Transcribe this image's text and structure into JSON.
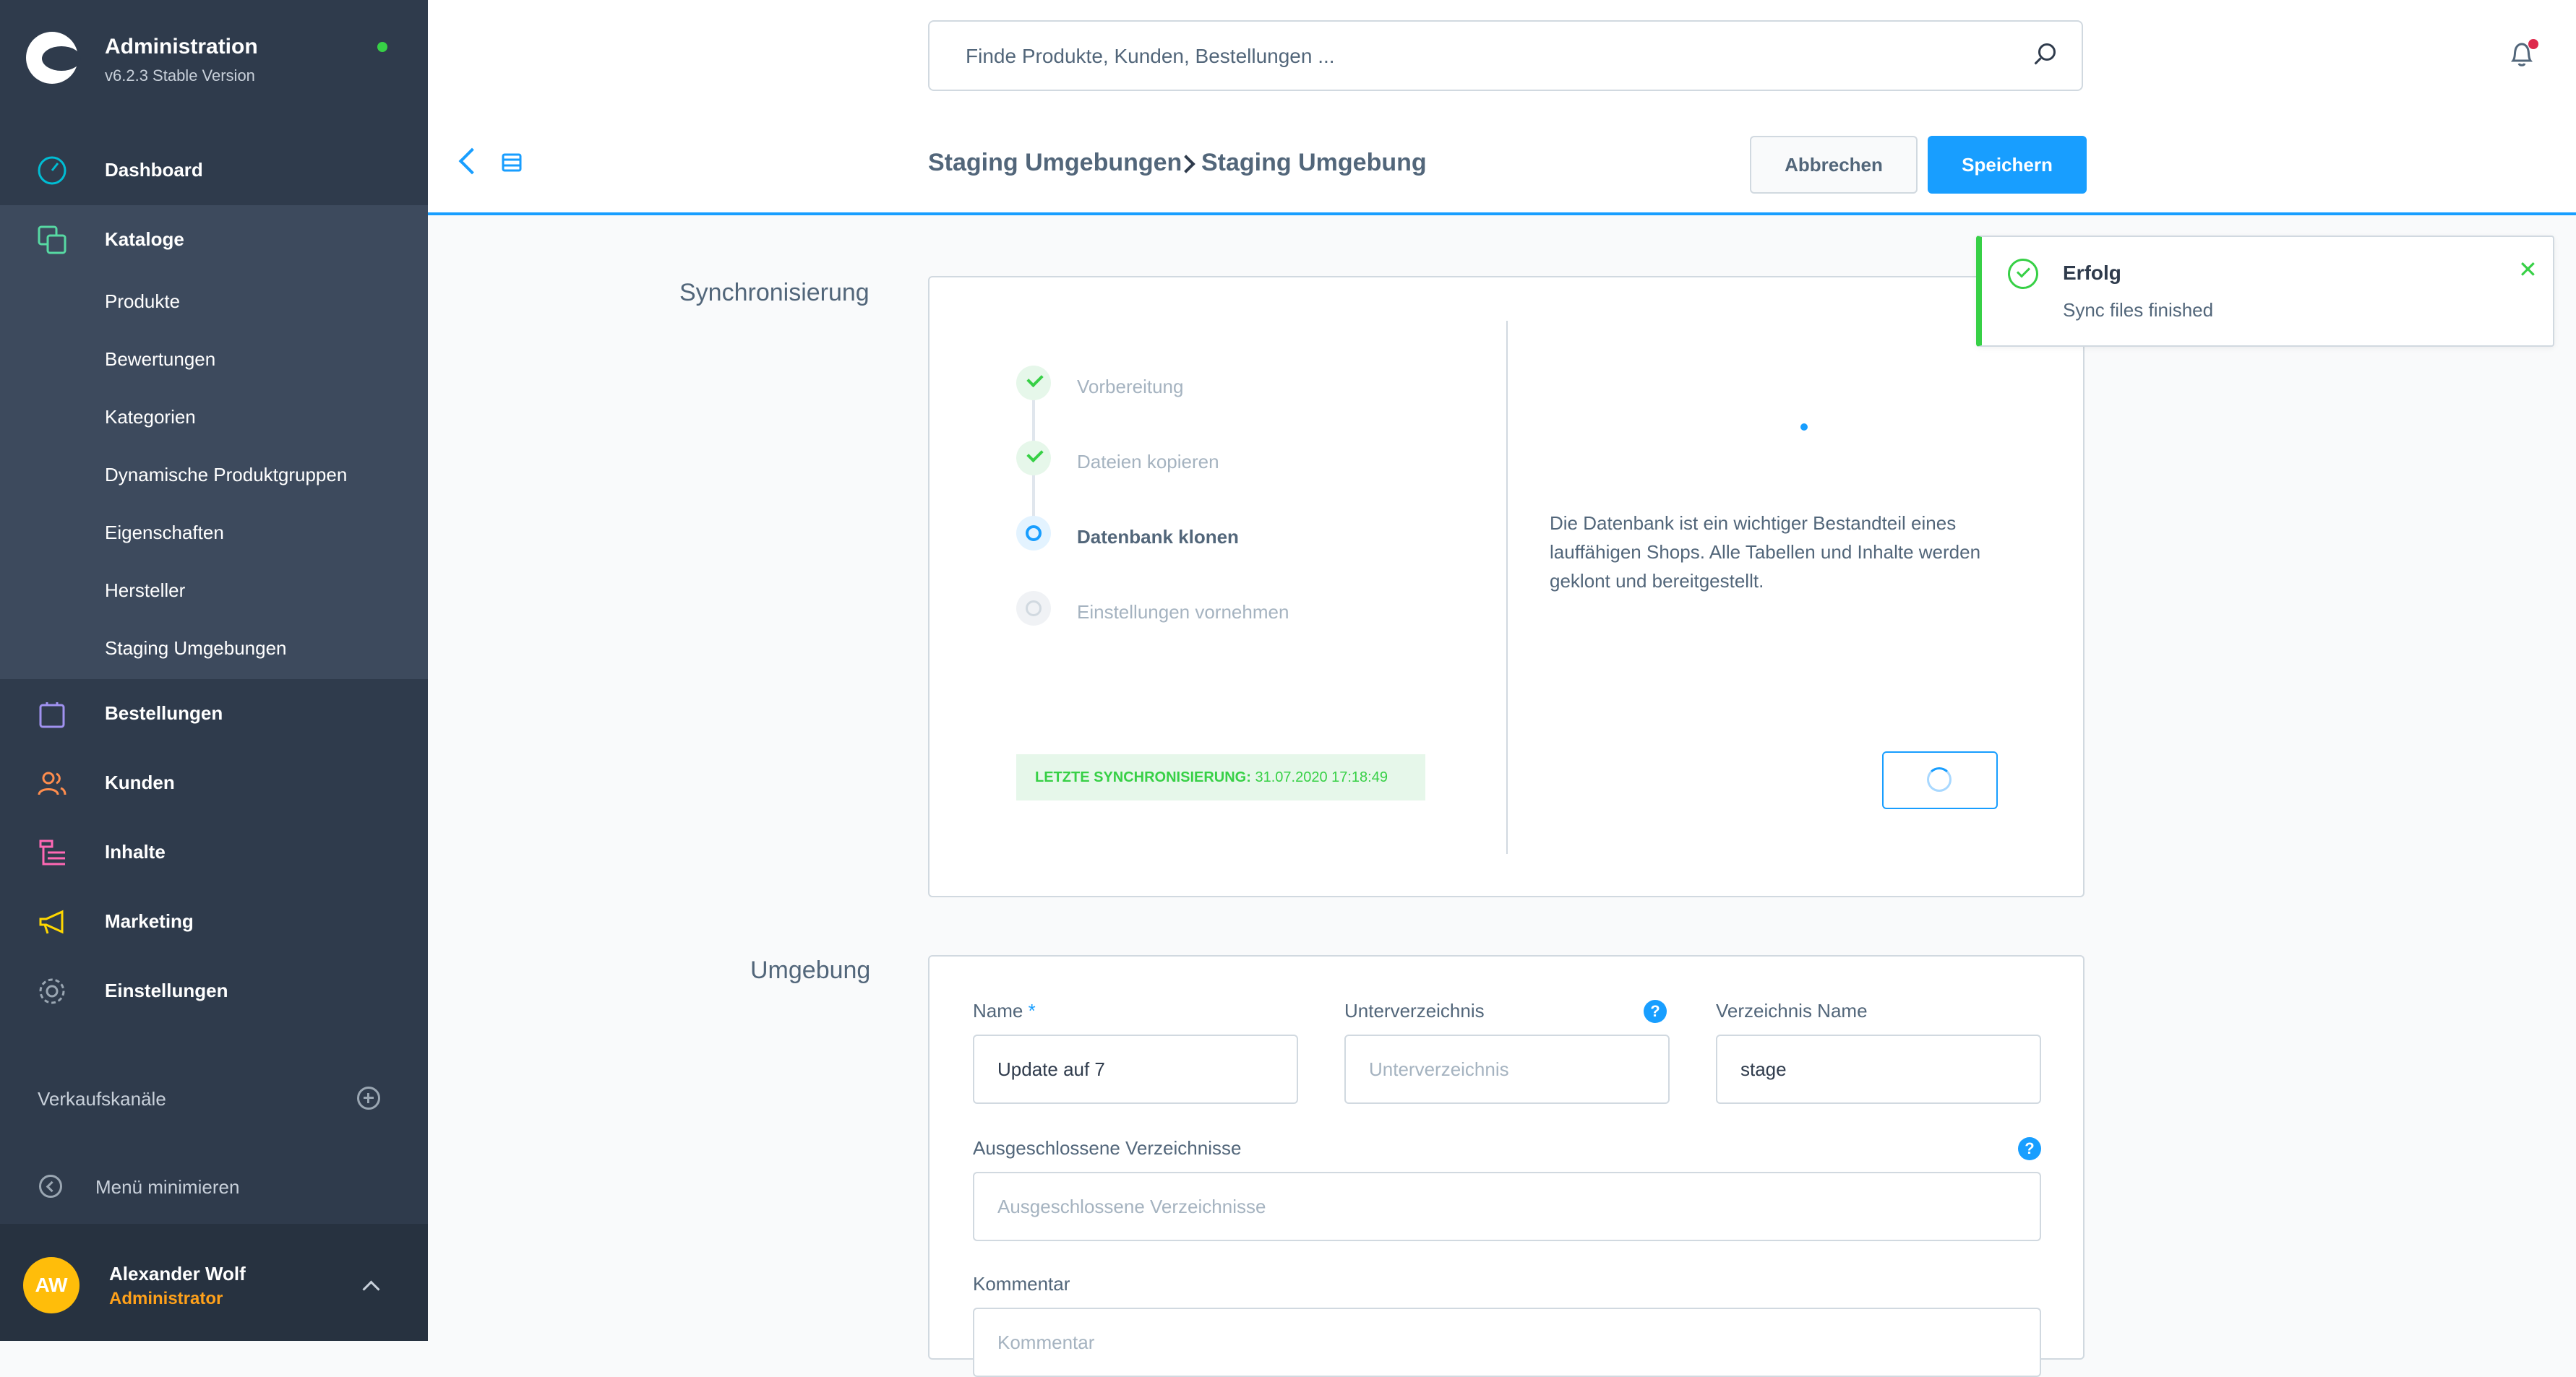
{
  "brand": {
    "title": "Administration",
    "version": "v6.2.3 Stable Version"
  },
  "sidebar": {
    "main": [
      {
        "label": "Dashboard",
        "icon": "dashboard-icon"
      },
      {
        "label": "Kataloge",
        "icon": "catalog-icon"
      },
      {
        "label": "Bestellungen",
        "icon": "orders-icon"
      },
      {
        "label": "Kunden",
        "icon": "customers-icon"
      },
      {
        "label": "Inhalte",
        "icon": "content-icon"
      },
      {
        "label": "Marketing",
        "icon": "marketing-icon"
      },
      {
        "label": "Einstellungen",
        "icon": "settings-icon"
      }
    ],
    "catalog_sub": [
      "Produkte",
      "Bewertungen",
      "Kategorien",
      "Dynamische Produktgruppen",
      "Eigenschaften",
      "Hersteller",
      "Staging Umgebungen"
    ],
    "sales_channels": "Verkaufskanäle",
    "minimize": "Menü minimieren"
  },
  "user": {
    "initials": "AW",
    "name": "Alexander Wolf",
    "role": "Administrator"
  },
  "search": {
    "placeholder": "Finde Produkte, Kunden, Bestellungen ..."
  },
  "breadcrumb": {
    "parent": "Staging Umgebungen",
    "current": "Staging Umgebung"
  },
  "actions": {
    "cancel": "Abbrechen",
    "save": "Speichern"
  },
  "sync": {
    "section_label": "Synchronisierung",
    "steps": [
      {
        "label": "Vorbereitung",
        "state": "done"
      },
      {
        "label": "Dateien kopieren",
        "state": "done"
      },
      {
        "label": "Datenbank klonen",
        "state": "active"
      },
      {
        "label": "Einstellungen vornehmen",
        "state": "todo"
      }
    ],
    "last_sync_label": "LETZTE SYNCHRONISIERUNG:",
    "last_sync_value": "31.07.2020 17:18:49",
    "description": "Die Datenbank ist ein wichtiger Bestandteil eines lauffähigen Shops. Alle Tabellen und Inhalte werden geklont und bereitgestellt."
  },
  "environment": {
    "section_label": "Umgebung",
    "name_label": "Name",
    "name_required": "*",
    "name_value": "Update auf 7",
    "subdir_label": "Unterverzeichnis",
    "subdir_placeholder": "Unterverzeichnis",
    "dirname_label": "Verzeichnis Name",
    "dirname_value": "stage",
    "excluded_label": "Ausgeschlossene Verzeichnisse",
    "excluded_placeholder": "Ausgeschlossene Verzeichnisse",
    "comment_label": "Kommentar",
    "comment_placeholder": "Kommentar",
    "help_glyph": "?"
  },
  "toast": {
    "title": "Erfolg",
    "message": "Sync files finished",
    "close_glyph": "✕"
  },
  "colors": {
    "accent": "#189eff",
    "sidebar": "#2f3b4c",
    "success": "#37d046",
    "avatar": "#ffbd0a"
  }
}
